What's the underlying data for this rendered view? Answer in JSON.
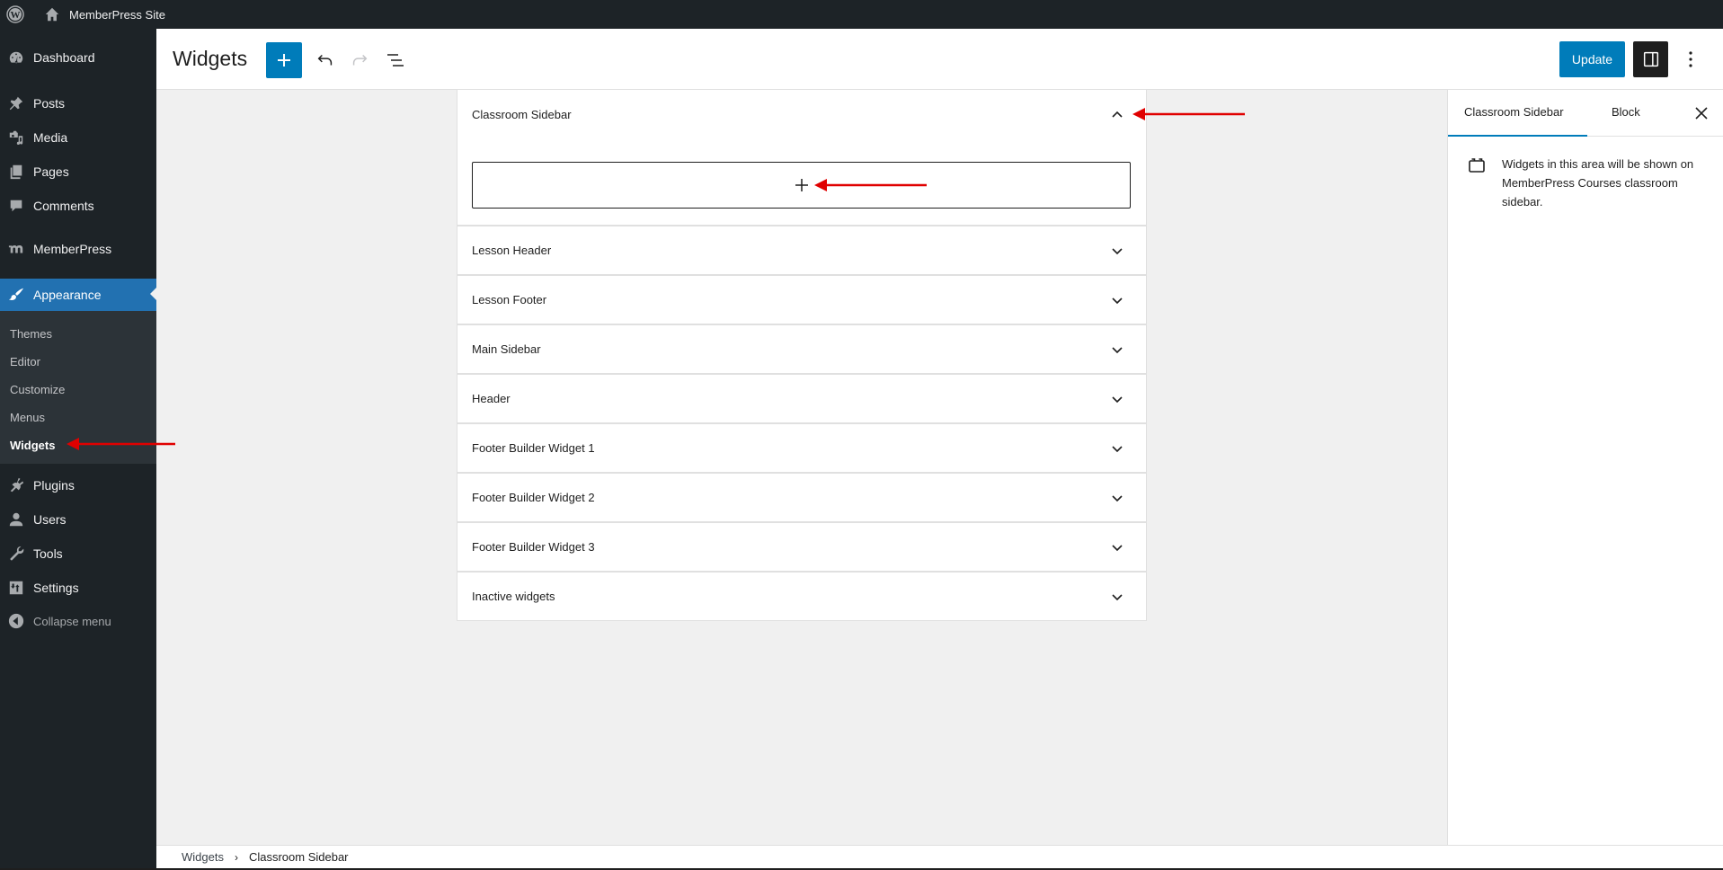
{
  "admin_bar": {
    "site_name": "MemberPress Site",
    "icons": [
      "wordpress-logo-icon",
      "home-icon"
    ]
  },
  "sidebar": {
    "items": [
      {
        "label": "Dashboard",
        "icon": "dashboard-icon"
      },
      {
        "label": "Posts",
        "icon": "pin-icon"
      },
      {
        "label": "Media",
        "icon": "media-icon"
      },
      {
        "label": "Pages",
        "icon": "pages-icon"
      },
      {
        "label": "Comments",
        "icon": "comment-icon"
      },
      {
        "label": "MemberPress",
        "icon": "memberpress-icon"
      },
      {
        "label": "Appearance",
        "icon": "paintbrush-icon",
        "active": true
      },
      {
        "label": "Plugins",
        "icon": "plugin-icon"
      },
      {
        "label": "Users",
        "icon": "user-icon"
      },
      {
        "label": "Tools",
        "icon": "wrench-icon"
      },
      {
        "label": "Settings",
        "icon": "settings-icon"
      }
    ],
    "submenu": [
      {
        "label": "Themes"
      },
      {
        "label": "Editor"
      },
      {
        "label": "Customize"
      },
      {
        "label": "Menus"
      },
      {
        "label": "Widgets",
        "current": true
      }
    ],
    "collapse_label": "Collapse menu"
  },
  "header": {
    "title": "Widgets",
    "add_block_label": "+",
    "update_label": "Update",
    "icons": [
      "plus-icon",
      "undo-icon",
      "redo-icon",
      "list-view-icon",
      "sidebar-toggle-icon",
      "kebab-icon"
    ]
  },
  "widget_areas": {
    "open_area": {
      "title": "Classroom Sidebar",
      "expanded": true,
      "appender_icon": "plus-icon"
    },
    "collapsed_areas": [
      {
        "title": "Lesson Header"
      },
      {
        "title": "Lesson Footer"
      },
      {
        "title": "Main Sidebar"
      },
      {
        "title": "Header"
      },
      {
        "title": "Footer Builder Widget 1"
      },
      {
        "title": "Footer Builder Widget 2"
      },
      {
        "title": "Footer Builder Widget 3"
      },
      {
        "title": "Inactive widgets"
      }
    ]
  },
  "inspector": {
    "tabs": [
      {
        "label": "Classroom Sidebar",
        "active": true
      },
      {
        "label": "Block",
        "active": false
      }
    ],
    "description": "Widgets in this area will be shown on MemberPress Courses classroom sidebar."
  },
  "breadcrumb": {
    "items": [
      "Widgets",
      "Classroom Sidebar"
    ],
    "separator": "›"
  },
  "colors": {
    "admin_dark": "#1d2327",
    "submenu_bg": "#2c3338",
    "active_menu": "#2271b1",
    "accent": "#007cba",
    "canvas_bg": "#f0f0f0",
    "annotation_arrow": "#e00000"
  }
}
